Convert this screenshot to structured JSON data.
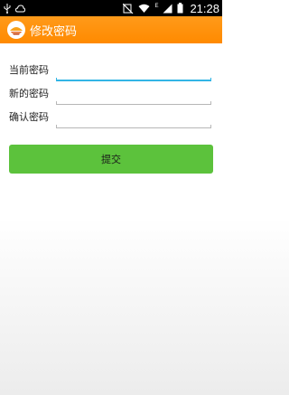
{
  "status_bar": {
    "time": "21:28",
    "network_type": "E",
    "left_icons": [
      "usb-icon",
      "cloud-icon"
    ],
    "right_icons": [
      "mute-icon",
      "wifi-icon",
      "signal-icon",
      "battery-icon"
    ]
  },
  "action_bar": {
    "title": "修改密码",
    "background_color": "#ff8a00",
    "icon": "app-logo-icon"
  },
  "form": {
    "fields": [
      {
        "label": "当前密码",
        "value": "",
        "placeholder": ""
      },
      {
        "label": "新的密码",
        "value": "",
        "placeholder": ""
      },
      {
        "label": "确认密码",
        "value": "",
        "placeholder": ""
      }
    ],
    "submit_label": "提交",
    "submit_color": "#5cc23c",
    "focus_color": "#33b5e5"
  }
}
